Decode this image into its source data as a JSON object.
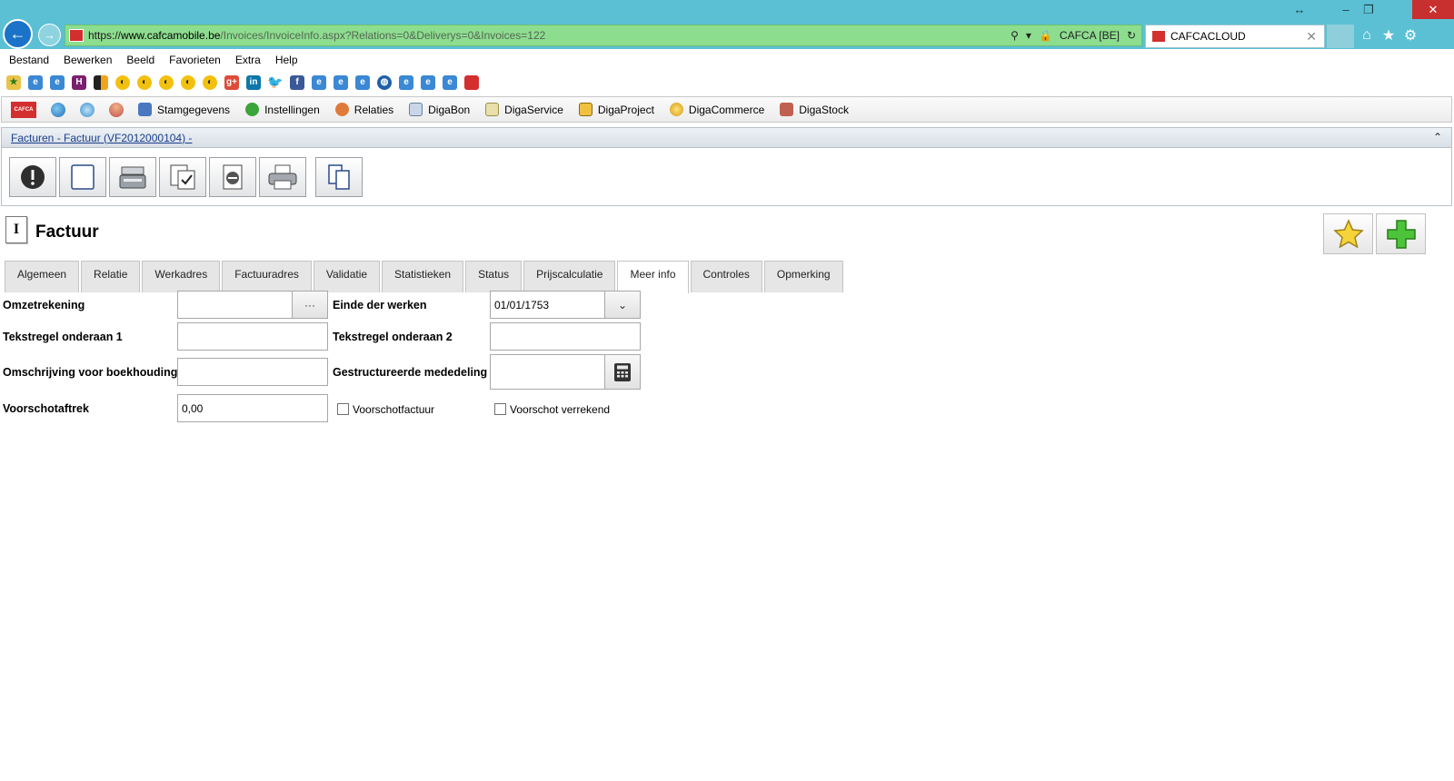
{
  "browser": {
    "url_scheme": "https://",
    "url_host": "www.cafcamobile.be",
    "url_path": "/Invoices/InvoiceInfo.aspx?Relations=0&Deliverys=0&Invoices=122",
    "site_identity": "CAFCA [BE]",
    "tab_title": "CAFCACLOUD"
  },
  "menu": {
    "items": [
      "Bestand",
      "Bewerken",
      "Beeld",
      "Favorieten",
      "Extra",
      "Help"
    ]
  },
  "app_logo_text": "CAFCA",
  "toolbar": {
    "items": [
      "Stamgegevens",
      "Instellingen",
      "Relaties",
      "DigaBon",
      "DigaService",
      "DigaProject",
      "DigaCommerce",
      "DigaStock"
    ]
  },
  "breadcrumb": "Facturen - Factuur (VF2012000104) -",
  "page": {
    "title_icon": "I",
    "title": "Factuur"
  },
  "tabs": [
    "Algemeen",
    "Relatie",
    "Werkadres",
    "Factuuradres",
    "Validatie",
    "Statistieken",
    "Status",
    "Prijscalculatie",
    "Meer info",
    "Controles",
    "Opmerking"
  ],
  "active_tab": "Meer info",
  "form": {
    "omzetrekening_label": "Omzetrekening",
    "omzetrekening_value": "",
    "omzetrekening_button": "···",
    "einde_label": "Einde der werken",
    "einde_value": "01/01/1753",
    "tekst1_label": "Tekstregel onderaan 1",
    "tekst1_value": "",
    "tekst2_label": "Tekstregel onderaan 2",
    "tekst2_value": "",
    "omschrijving_label": "Omschrijving voor boekhouding",
    "omschrijving_value": "",
    "mededeling_label": "Gestructureerde mededeling",
    "mededeling_value": "",
    "voorschot_label": "Voorschotaftrek",
    "voorschot_value": "0,00",
    "voorschotfactuur_label": "Voorschotfactuur",
    "voorschotfactuur_checked": false,
    "verrekend_label": "Voorschot verrekend",
    "verrekend_checked": false
  },
  "colors": {
    "titlebar": "#5bc0d4",
    "addressbar": "#8ddd8f",
    "close_button": "#c8302f",
    "link": "#1a3e8c"
  }
}
